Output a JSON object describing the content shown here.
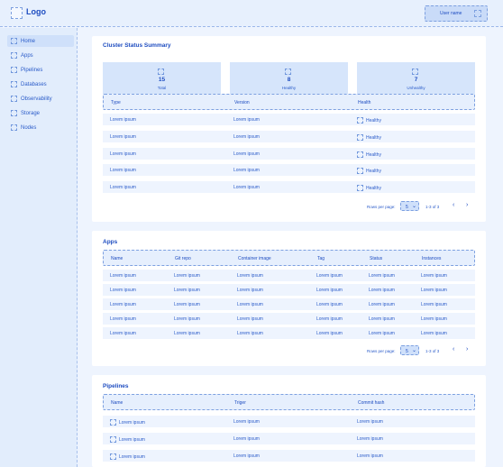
{
  "header": {
    "logo": "Logo",
    "user": "User name"
  },
  "sidebar": {
    "items": [
      {
        "label": "Home"
      },
      {
        "label": "Apps"
      },
      {
        "label": "Pipelines"
      },
      {
        "label": "Databases"
      },
      {
        "label": "Observability"
      },
      {
        "label": "Storage"
      },
      {
        "label": "Nodes"
      }
    ]
  },
  "cluster": {
    "title": "Cluster Status Summary",
    "stats": [
      {
        "value": "15",
        "label": "Total"
      },
      {
        "value": "8",
        "label": "Healthy"
      },
      {
        "value": "7",
        "label": "Unhealthy"
      }
    ],
    "columns": [
      "Type",
      "Version",
      "Health"
    ],
    "rows": [
      [
        "Lorem ipsum",
        "Lorem ipsum",
        "Healthy"
      ],
      [
        "Lorem ipsum",
        "Lorem ipsum",
        "Healthy"
      ],
      [
        "Lorem ipsum",
        "Lorem ipsum",
        "Healthy"
      ],
      [
        "Lorem ipsum",
        "Lorem ipsum",
        "Healthy"
      ],
      [
        "Lorem ipsum",
        "Lorem ipsum",
        "Healthy"
      ]
    ],
    "pager": {
      "label": "Rows per page:",
      "value": "5",
      "range": "1-3 of 3"
    }
  },
  "apps": {
    "title": "Apps",
    "columns": [
      "Name",
      "Git repo",
      "Container image",
      "Tag",
      "Status",
      "Instances"
    ],
    "rows": [
      [
        "Lorem ipsum",
        "Lorem ipsum",
        "Lorem ipsum",
        "Lorem ipsum",
        "Lorem ipsum",
        "Lorem ipsum"
      ],
      [
        "Lorem ipsum",
        "Lorem ipsum",
        "Lorem ipsum",
        "Lorem ipsum",
        "Lorem ipsum",
        "Lorem ipsum"
      ],
      [
        "Lorem ipsum",
        "Lorem ipsum",
        "Lorem ipsum",
        "Lorem ipsum",
        "Lorem ipsum",
        "Lorem ipsum"
      ],
      [
        "Lorem ipsum",
        "Lorem ipsum",
        "Lorem ipsum",
        "Lorem ipsum",
        "Lorem ipsum",
        "Lorem ipsum"
      ],
      [
        "Lorem ipsum",
        "Lorem ipsum",
        "Lorem ipsum",
        "Lorem ipsum",
        "Lorem ipsum",
        "Lorem ipsum"
      ]
    ],
    "pager": {
      "label": "Rows per page:",
      "value": "5",
      "range": "1-3 of 3"
    }
  },
  "pipelines": {
    "title": "Pipelines",
    "columns": [
      "Name",
      "Triger",
      "Commit hash"
    ],
    "rows": [
      [
        "Lorem ipsum",
        "Lorem ipsum",
        "Lorem ipsum"
      ],
      [
        "Lorem ipsum",
        "Lorem ipsum",
        "Lorem ipsum"
      ],
      [
        "Lorem ipsum",
        "Lorem ipsum",
        "Lorem ipsum"
      ]
    ]
  },
  "icons": {
    "chevron_down": "⌄",
    "prev": "‹",
    "next": "›"
  }
}
